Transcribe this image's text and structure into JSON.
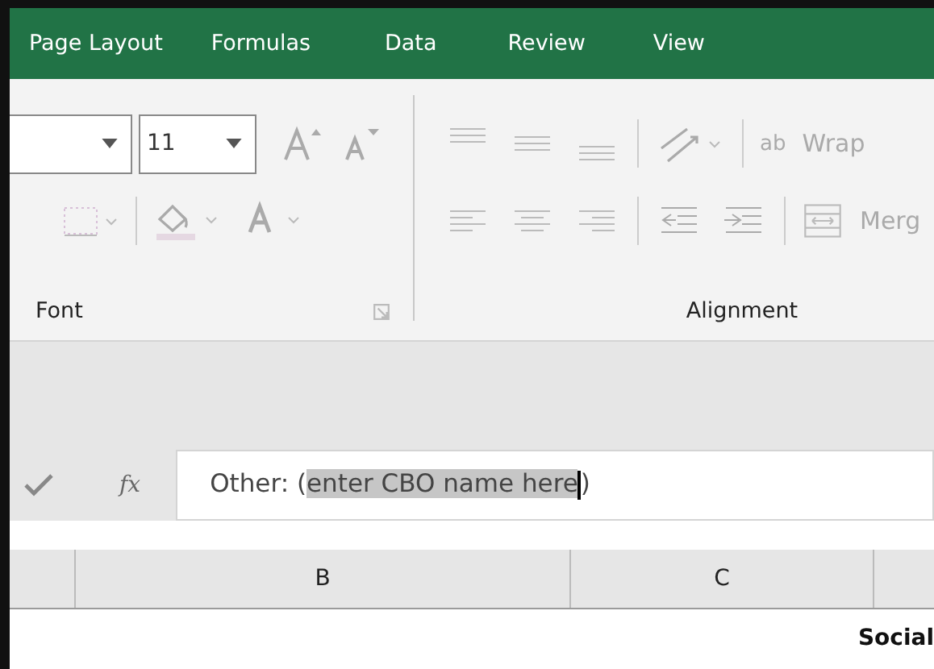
{
  "tabs": [
    {
      "label": "Page Layout"
    },
    {
      "label": "Formulas"
    },
    {
      "label": "Data"
    },
    {
      "label": "Review"
    },
    {
      "label": "View"
    }
  ],
  "ribbon": {
    "font_group": {
      "label": "Font",
      "font_size": "11"
    },
    "alignment_group": {
      "label": "Alignment",
      "wrap_icon": "ab",
      "wrap_text": "Wrap",
      "merge": "Merg"
    }
  },
  "formula_bar": {
    "function_icon": "fx",
    "value_before": "Other: (",
    "value_selected": "enter CBO name here",
    "value_after": ")"
  },
  "columns": [
    "B",
    "C"
  ],
  "cell_text": "Social"
}
